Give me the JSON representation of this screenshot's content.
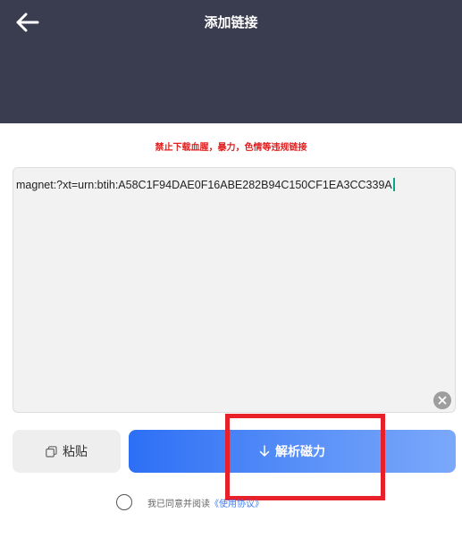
{
  "header": {
    "title": "添加链接",
    "back_icon": "arrow-left-icon",
    "bg_color": "#3a3c4f"
  },
  "notice": {
    "warning": "禁止下载血腥，暴力，色情等违规链接",
    "color": "#e02020"
  },
  "link_input": {
    "value": "magnet:?xt=urn:btih:A58C1F94DAE0F16ABE282B94C150CF1EA3CC339A",
    "clear_icon": "clear-circle-icon"
  },
  "actions": {
    "paste_label": "粘贴",
    "paste_icon": "clipboard-icon",
    "parse_label": "解析磁力",
    "parse_icon": "download-arrow-icon",
    "accent_color": "#2d6ff5"
  },
  "agreement": {
    "text": "我已同意并阅读",
    "link_text": "《使用协议》"
  }
}
